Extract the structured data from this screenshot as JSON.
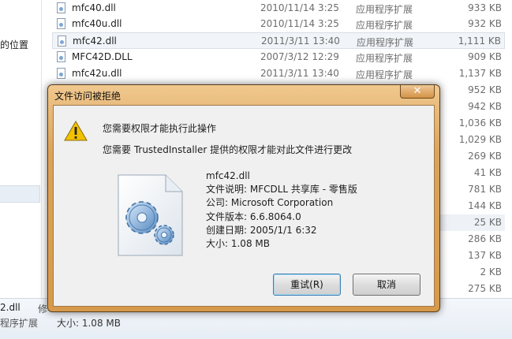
{
  "explorer": {
    "nav_partial_label": "的位置",
    "files": [
      {
        "name": "mfc40.dll",
        "date": "2010/11/14 3:25",
        "type": "应用程序扩展",
        "size": "933 KB"
      },
      {
        "name": "mfc40u.dll",
        "date": "2010/11/14 3:25",
        "type": "应用程序扩展",
        "size": "932 KB"
      },
      {
        "name": "mfc42.dll",
        "date": "2011/3/11 13:40",
        "type": "应用程序扩展",
        "size": "1,111 KB"
      },
      {
        "name": "MFC42D.DLL",
        "date": "2007/3/12 12:29",
        "type": "应用程序扩展",
        "size": "909 KB"
      },
      {
        "name": "mfc42u.dll",
        "date": "2011/3/11 13:40",
        "type": "应用程序扩展",
        "size": "1,137 KB"
      }
    ],
    "hidden_sizes": [
      "952 KB",
      "942 KB",
      "1,036 KB",
      "1,029 KB",
      "269 KB",
      "41 KB",
      "781 KB",
      "144 KB",
      "25 KB",
      "286 KB",
      "137 KB",
      "2 KB",
      "275 KB"
    ],
    "status": {
      "name_partial": "2.dll",
      "modified_partial": "修",
      "type_partial": "程序扩展",
      "size": "大小: 1.08 MB"
    }
  },
  "dialog": {
    "title": "文件访问被拒绝",
    "close_glyph": "✕",
    "message1": "您需要权限才能执行此操作",
    "message2": "您需要 TrustedInstaller 提供的权限才能对此文件进行更改",
    "file": {
      "name": "mfc42.dll",
      "description": "文件说明: MFCDLL 共享库 - 零售版",
      "company": "公司: Microsoft Corporation",
      "version": "文件版本: 6.6.8064.0",
      "created": "创建日期: 2005/1/1 6:32",
      "size": "大小: 1.08 MB"
    },
    "retry_label": "重试(R)",
    "cancel_label": "取消",
    "icons": {
      "warning": "warning-icon",
      "file": "dll-file-gear-icon"
    },
    "colors": {
      "frame": "#dba45a",
      "warning": "#f2c200"
    }
  }
}
